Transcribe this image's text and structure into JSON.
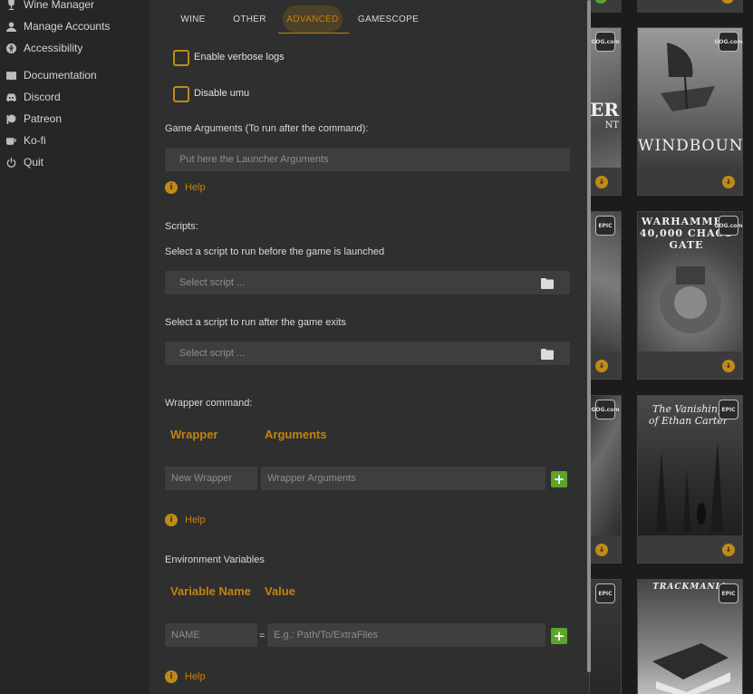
{
  "sidebar": {
    "items": [
      {
        "label": "Wine Manager",
        "icon": "wine-icon"
      },
      {
        "label": "Manage Accounts",
        "icon": "user-icon"
      },
      {
        "label": "Accessibility",
        "icon": "accessibility-icon"
      },
      {
        "label": "Documentation",
        "icon": "book-icon"
      },
      {
        "label": "Discord",
        "icon": "discord-icon"
      },
      {
        "label": "Patreon",
        "icon": "patreon-icon"
      },
      {
        "label": "Ko-fi",
        "icon": "coffee-icon"
      },
      {
        "label": "Quit",
        "icon": "power-icon"
      }
    ]
  },
  "tabs": [
    {
      "label": "WINE"
    },
    {
      "label": "OTHER"
    },
    {
      "label": "ADVANCED"
    },
    {
      "label": "GAMESCOPE"
    }
  ],
  "active_tab": "ADVANCED",
  "advanced": {
    "verbose_logs_label": "Enable verbose logs",
    "disable_umu_label": "Disable umu",
    "game_args_label": "Game Arguments (To run after the command):",
    "game_args_placeholder": "Put here the Launcher Arguments",
    "help_label": "Help",
    "scripts_label": "Scripts:",
    "before_script_label": "Select a script to run before the game is launched",
    "after_script_label": "Select a script to run after the game exits",
    "script_placeholder": "Select script ...",
    "wrapper_label": "Wrapper command:",
    "wrapper_col": "Wrapper",
    "arguments_col": "Arguments",
    "wrapper_placeholder": "New Wrapper",
    "wrapper_args_placeholder": "Wrapper Arguments",
    "env_label": "Environment Variables",
    "var_name_col": "Variable Name",
    "value_col": "Value",
    "env_name_placeholder": "NAME",
    "env_value_placeholder": "E.g.: Path/To/ExtraFiles",
    "equals": "=",
    "add_symbol": "+"
  },
  "library": {
    "cards": [
      {
        "title": "WINDBOUND",
        "store": "GOG.com"
      },
      {
        "title": "WARHAMMER 40,000 CHAOS GATE",
        "store": "EPIC"
      },
      {
        "title": "The Vanishing of Ethan Carter",
        "store": "EPIC"
      },
      {
        "title": "TRACKMANIA",
        "store": "EPIC"
      }
    ],
    "partial_title": "ER",
    "partial_subtitle": "NT",
    "store_gog": "GOG.com",
    "store_epic": "EPIC"
  },
  "colors": {
    "accent": "#c2830f",
    "panel_bg": "#2f2f2f",
    "sidebar_bg": "#262626",
    "add_button": "#5aa52a"
  }
}
